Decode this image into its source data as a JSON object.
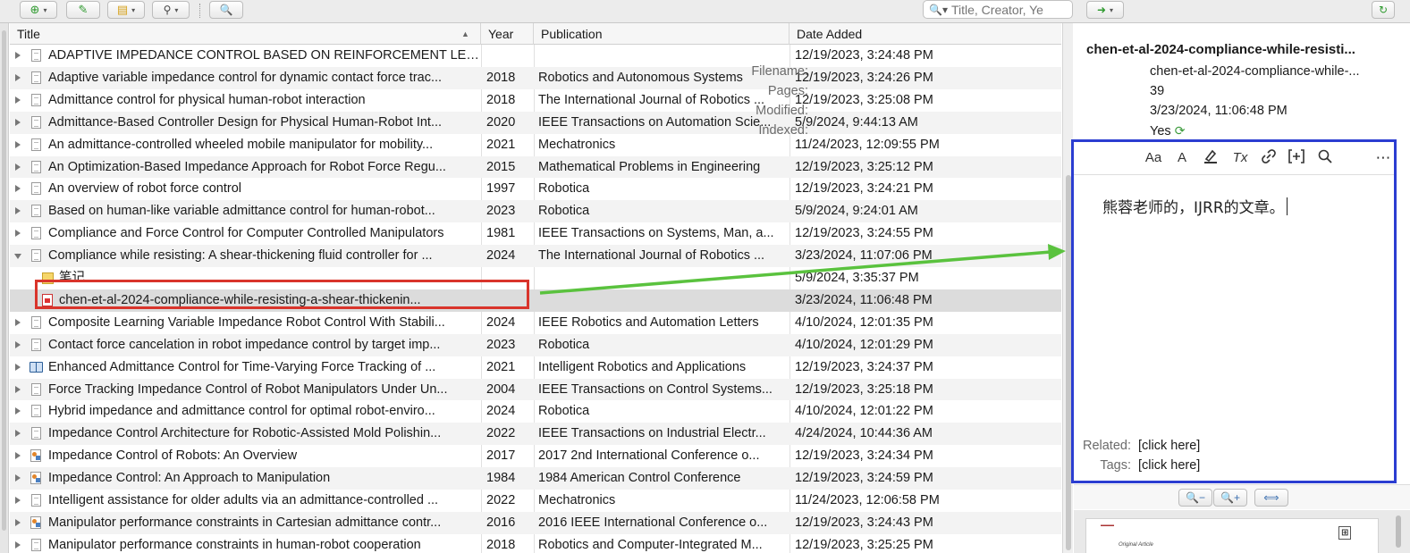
{
  "toolbar": {
    "search_placeholder": "Title, Creator, Ye"
  },
  "columns": {
    "title": "Title",
    "year": "Year",
    "publication": "Publication",
    "date_added": "Date Added"
  },
  "rows": [
    {
      "title": "ADAPTIVE IMPEDANCE CONTROL BASED ON REINFORCEMENT LEAR...",
      "year": "",
      "pub": "",
      "date": "12/19/2023, 3:24:48 PM"
    },
    {
      "title": "Adaptive variable impedance control for dynamic contact force trac...",
      "year": "2018",
      "pub": "Robotics and Autonomous Systems",
      "date": "12/19/2023, 3:24:26 PM"
    },
    {
      "title": "Admittance control for physical human-robot interaction",
      "year": "2018",
      "pub": "The International Journal of Robotics ...",
      "date": "12/19/2023, 3:25:08 PM"
    },
    {
      "title": "Admittance-Based Controller Design for Physical Human-Robot Int...",
      "year": "2020",
      "pub": "IEEE Transactions on Automation Scie...",
      "date": "5/9/2024, 9:44:13 AM"
    },
    {
      "title": "An admittance-controlled wheeled mobile manipulator for mobility...",
      "year": "2021",
      "pub": "Mechatronics",
      "date": "11/24/2023, 12:09:55 PM"
    },
    {
      "title": "An Optimization-Based Impedance Approach for Robot Force Regu...",
      "year": "2015",
      "pub": "Mathematical Problems in Engineering",
      "date": "12/19/2023, 3:25:12 PM"
    },
    {
      "title": "An overview of robot force control",
      "year": "1997",
      "pub": "Robotica",
      "date": "12/19/2023, 3:24:21 PM"
    },
    {
      "title": "Based on human-like variable admittance control for human-robot...",
      "year": "2023",
      "pub": "Robotica",
      "date": "5/9/2024, 9:24:01 AM"
    },
    {
      "title": "Compliance and Force Control for Computer Controlled Manipulators",
      "year": "1981",
      "pub": "IEEE Transactions on Systems, Man, a...",
      "date": "12/19/2023, 3:24:55 PM"
    },
    {
      "title": "Compliance while resisting: A shear-thickening fluid controller for ...",
      "year": "2024",
      "pub": "The International Journal of Robotics ...",
      "date": "3/23/2024, 11:07:06 PM"
    },
    {
      "title": "笔记",
      "year": "",
      "pub": "",
      "date": "5/9/2024, 3:35:37 PM"
    },
    {
      "title": "chen-et-al-2024-compliance-while-resisting-a-shear-thickenin...",
      "year": "",
      "pub": "",
      "date": "3/23/2024, 11:06:48 PM"
    },
    {
      "title": "Composite Learning Variable Impedance Robot Control With Stabili...",
      "year": "2024",
      "pub": "IEEE Robotics and Automation Letters",
      "date": "4/10/2024, 12:01:35 PM"
    },
    {
      "title": "Contact force cancelation in robot impedance control by target imp...",
      "year": "2023",
      "pub": "Robotica",
      "date": "4/10/2024, 12:01:29 PM"
    },
    {
      "title": "Enhanced Admittance Control for Time-Varying Force Tracking of ...",
      "year": "2021",
      "pub": "Intelligent Robotics and Applications",
      "date": "12/19/2023, 3:24:37 PM"
    },
    {
      "title": "Force Tracking Impedance Control of Robot Manipulators Under Un...",
      "year": "2004",
      "pub": "IEEE Transactions on Control Systems...",
      "date": "12/19/2023, 3:25:18 PM"
    },
    {
      "title": "Hybrid impedance and admittance control for optimal robot-enviro...",
      "year": "2024",
      "pub": "Robotica",
      "date": "4/10/2024, 12:01:22 PM"
    },
    {
      "title": "Impedance Control Architecture for Robotic-Assisted Mold Polishin...",
      "year": "2022",
      "pub": "IEEE Transactions on Industrial Electr...",
      "date": "4/24/2024, 10:44:36 AM"
    },
    {
      "title": "Impedance Control of Robots: An Overview",
      "year": "2017",
      "pub": "2017 2nd International Conference o...",
      "date": "12/19/2023, 3:24:34 PM"
    },
    {
      "title": "Impedance Control: An Approach to Manipulation",
      "year": "1984",
      "pub": "1984 American Control Conference",
      "date": "12/19/2023, 3:24:59 PM"
    },
    {
      "title": "Intelligent assistance for older adults via an admittance-controlled ...",
      "year": "2022",
      "pub": "Mechatronics",
      "date": "11/24/2023, 12:06:58 PM"
    },
    {
      "title": "Manipulator performance constraints in Cartesian admittance contr...",
      "year": "2016",
      "pub": "2016 IEEE International Conference o...",
      "date": "12/19/2023, 3:24:43 PM"
    },
    {
      "title": "Manipulator performance constraints in human-robot cooperation",
      "year": "2018",
      "pub": "Robotics and Computer-Integrated M...",
      "date": "12/19/2023, 3:25:25 PM"
    }
  ],
  "row_icons": [
    "doc-icon",
    "doc-icon",
    "doc-icon",
    "doc-icon",
    "doc-icon",
    "doc-icon",
    "doc-icon",
    "doc-icon",
    "doc-icon",
    "doc-icon",
    "note-icon",
    "pdf-icon",
    "doc-icon",
    "doc-icon",
    "book-icon",
    "doc-icon",
    "doc-icon",
    "doc-icon",
    "conf-icon",
    "conf-icon",
    "doc-icon",
    "conf-icon",
    "doc-icon"
  ],
  "attachment": {
    "title": "chen-et-al-2024-compliance-while-resisti...",
    "filename_label": "Filename:",
    "filename": "chen-et-al-2024-compliance-while-...",
    "pages_label": "Pages:",
    "pages": "39",
    "modified_label": "Modified:",
    "modified": "3/23/2024, 11:06:48 PM",
    "indexed_label": "Indexed:",
    "indexed": "Yes"
  },
  "note_toolbar": {
    "text_format": "Aa",
    "text_color": "A",
    "clear_format": "Tx",
    "more": "⋯"
  },
  "note": {
    "text": "熊蓉老师的，IJRR的文章。"
  },
  "related": {
    "related_label": "Related:",
    "related_value": "[click here]",
    "tags_label": "Tags:",
    "tags_value": "[click here]"
  },
  "preview": {
    "article_label": "Original Article"
  },
  "colors": {
    "highlight_red": "#d9342b",
    "highlight_blue": "#2b3dd1",
    "arrow_green": "#5ac23e"
  }
}
